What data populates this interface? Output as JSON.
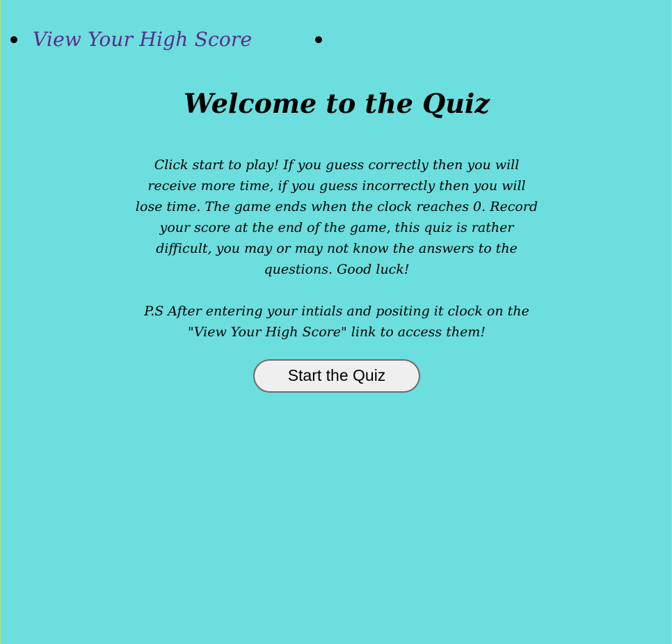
{
  "nav": {
    "items": [
      {
        "label": "View Your High Score"
      },
      {
        "label": ""
      }
    ]
  },
  "main": {
    "title": "Welcome to the Quiz",
    "paragraphs": [
      "Click start to play! If you guess correctly then you will receive more time, if you guess incorrectly then you will lose time. The game ends when the clock reaches 0. Record your score at the end of the game, this quiz is rather difficult, you may or may not know the answers to the questions. Good luck!",
      "P.S After entering your intials and positing it clock on the \"View Your High Score\" link to access them!"
    ],
    "start_button_label": "Start the Quiz"
  },
  "colors": {
    "background": "#6bdedd",
    "link": "#5b2b8b",
    "text": "#000000",
    "button_background": "#efefef",
    "button_border": "#6c6c6c"
  },
  "icons": {
    "bullet": "disc-bullet-icon"
  }
}
